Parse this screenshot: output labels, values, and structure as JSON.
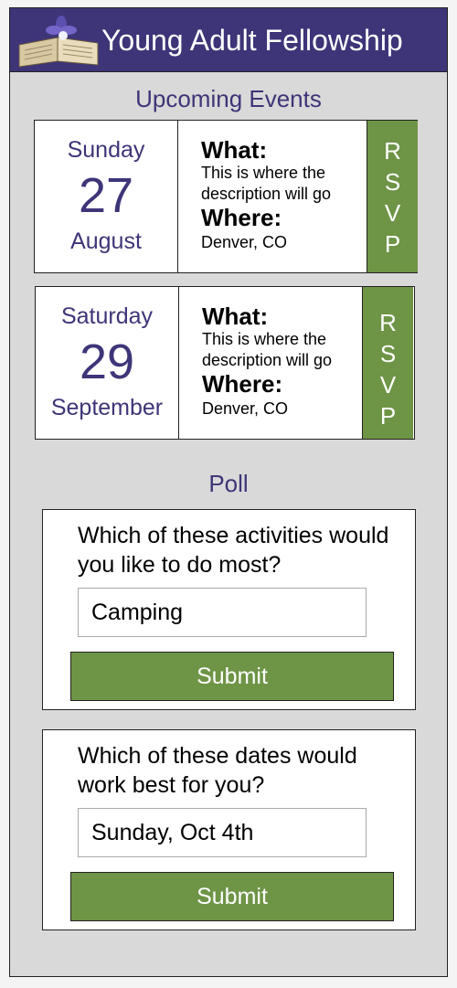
{
  "header": {
    "title": "Young Adult Fellowship",
    "logo_icon": "bible-with-flower-icon"
  },
  "events_section": {
    "title": "Upcoming Events"
  },
  "events": [
    {
      "day_of_week": "Sunday",
      "day": "27",
      "month": "August",
      "what_label": "What:",
      "description": "This is where the description will go",
      "where_label": "Where:",
      "location": "Denver, CO",
      "rsvp": [
        "R",
        "S",
        "V",
        "P"
      ]
    },
    {
      "day_of_week": "Saturday",
      "day": "29",
      "month": "September",
      "what_label": "What:",
      "description": "This is where the description will go",
      "where_label": "Where:",
      "location": "Denver, CO",
      "rsvp": [
        "R",
        "S",
        "V",
        "P"
      ]
    }
  ],
  "poll_section": {
    "title": "Poll"
  },
  "polls": [
    {
      "question": "Which of these activities would you like to do most?",
      "answer": "Camping",
      "submit_label": "Submit"
    },
    {
      "question": "Which of these dates would work best for you?",
      "answer": "Sunday, Oct 4th",
      "submit_label": "Submit"
    }
  ],
  "colors": {
    "brand": "#3d3578",
    "accent": "#6e9446",
    "panel": "#d9d9d9"
  }
}
